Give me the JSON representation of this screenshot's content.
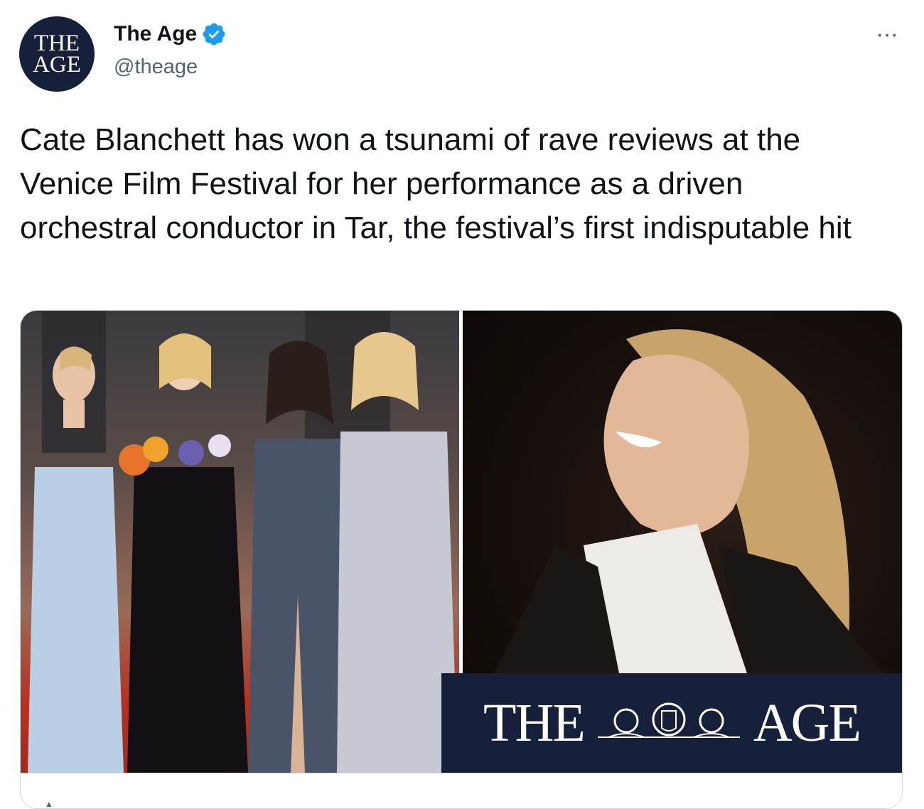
{
  "author": {
    "avatar_line1": "THE",
    "avatar_line2": "AGE",
    "display_name": "The Age",
    "handle": "@theage",
    "verified": true
  },
  "more_menu": "···",
  "tweet": {
    "text": "Cate Blanchett has won a tsunami of rave reviews at the Venice Film Festival for her performance as a driven orchestral conductor in Tar, the festival’s first indisputable hit"
  },
  "media": {
    "brand_left": "THE",
    "brand_right": "AGE"
  },
  "colors": {
    "verified_blue": "#1d9bf0",
    "brand_navy": "#16203a",
    "secondary_text": "#536471"
  }
}
